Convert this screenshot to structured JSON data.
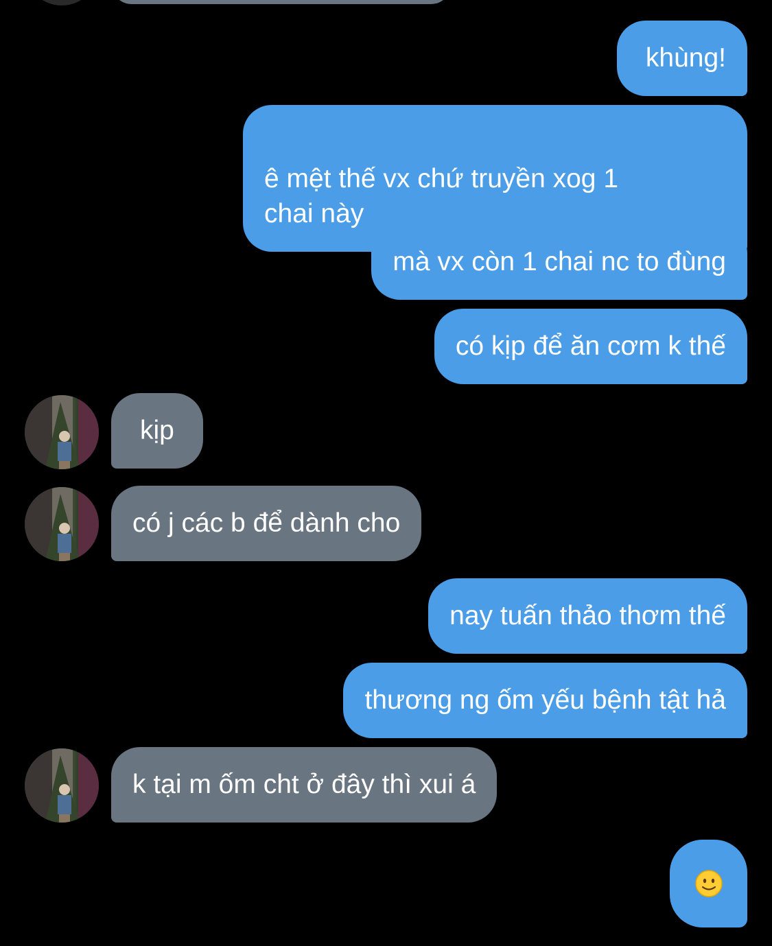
{
  "messages": [
    {
      "side": "sent",
      "text": "khùng!"
    },
    {
      "side": "sent",
      "text": "ê mệt thế vx chứ truyền xog 1\nchai này"
    },
    {
      "side": "sent",
      "text": "mà vx còn 1 chai nc to đùng"
    },
    {
      "side": "sent",
      "text": "có kịp để ăn cơm k thế"
    },
    {
      "side": "received",
      "text": "kịp"
    },
    {
      "side": "received",
      "text": "có j các b để dành cho"
    },
    {
      "side": "sent",
      "text": "nay tuấn thảo thơm thế"
    },
    {
      "side": "sent",
      "text": "thương ng ốm yếu bệnh tật hả"
    },
    {
      "side": "received",
      "text": "k tại m ốm cht ở đây thì xui á"
    },
    {
      "side": "sent",
      "emoji": "slightly-smiling-face-icon"
    }
  ],
  "colors": {
    "background": "#000000",
    "sent_bubble": "#4b9de8",
    "received_bubble": "#697581",
    "text": "#ffffff"
  }
}
